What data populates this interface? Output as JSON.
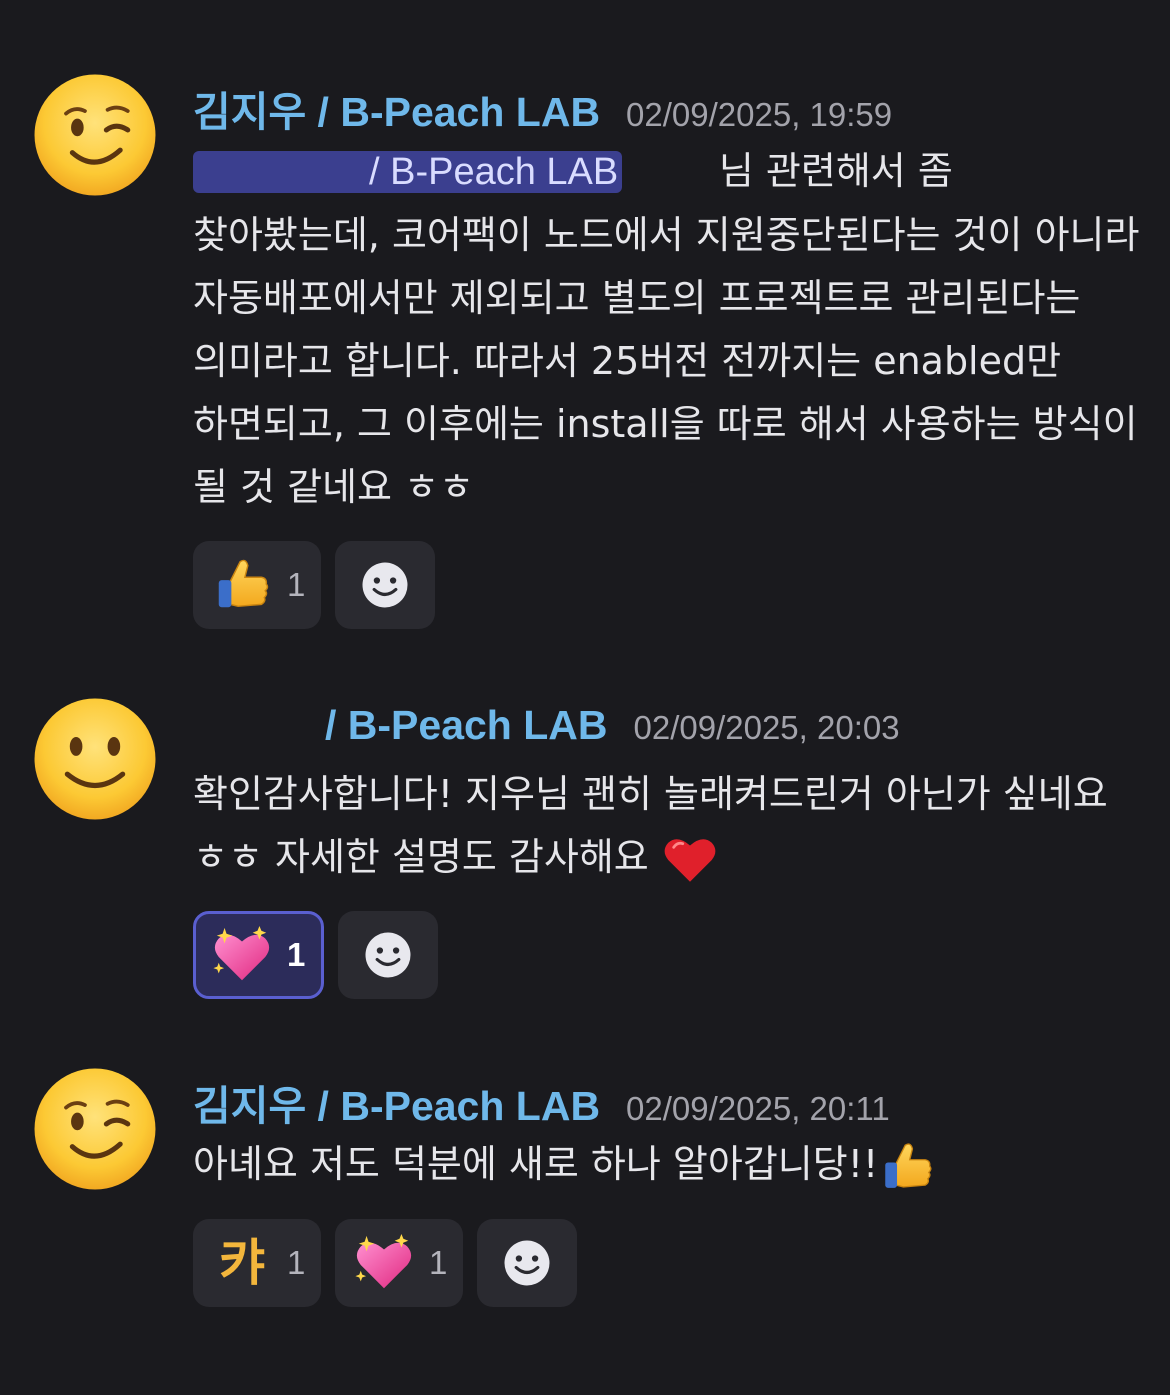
{
  "messages": [
    {
      "avatar_icon": "winking-face-icon",
      "author": "김지우 / B-Peach LAB",
      "timestamp": "02/09/2025, 19:59",
      "mention_suffix": "/ B-Peach LAB",
      "body_after_mention": "        님 관련해서 좀 찾아봤는데, 코어팩이 노드에서 지원중단된다는 것이 아니라 자동배포에서만 제외되고 별도의 프로젝트로 관리된다는 의미라고 합니다. 따라서 25버전 전까지는 enabled만 하면되고, 그 이후에는 install을 따로 해서 사용하는 방식이 될 것 같네요 ㅎㅎ",
      "reactions": [
        {
          "emoji": "thumbs-up-icon",
          "count": "1",
          "active": false
        }
      ]
    },
    {
      "avatar_icon": "slightly-smiling-face-icon",
      "author_suffix": "/ B-Peach LAB",
      "timestamp": "02/09/2025, 20:03",
      "body": "확인감사합니다! 지우님 괜히 놀래켜드린거 아닌가 싶네요 ㅎㅎ 자세한 설명도 감사해요",
      "body_emoji": "red-heart-icon",
      "reactions": [
        {
          "emoji": "sparkling-heart-icon",
          "count": "1",
          "active": true
        }
      ]
    },
    {
      "avatar_icon": "winking-face-icon",
      "author": "김지우 / B-Peach LAB",
      "timestamp": "02/09/2025, 20:11",
      "body": "아녜요 저도 덕분에 새로 하나 알아갑니당!!",
      "body_emoji": "thumbs-up-icon",
      "reactions": [
        {
          "emoji_text": "캬",
          "count": "1",
          "active": false
        },
        {
          "emoji": "sparkling-heart-icon",
          "count": "1",
          "active": false
        }
      ]
    }
  ],
  "add_reaction_icon": "add-reaction-smiley-icon",
  "colors": {
    "background": "#1a1a1e",
    "author": "#6fb8ea",
    "timestamp": "#a3a3ab",
    "mention_bg": "#3b3f8f",
    "reaction_bg": "#2a2a30",
    "reaction_active_bg": "#2c2c5a",
    "reaction_active_border": "#5a5fd0"
  }
}
